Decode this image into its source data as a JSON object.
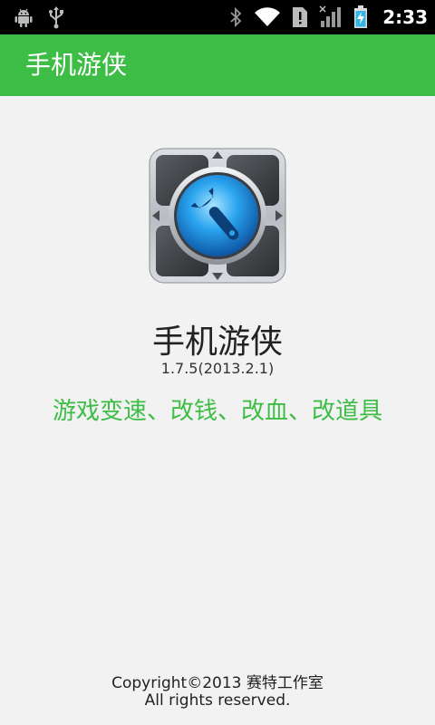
{
  "status_bar": {
    "time": "2:33",
    "left_icons": [
      "android-debug-icon",
      "usb-icon"
    ],
    "right_icons": [
      "bluetooth-icon",
      "wifi-icon",
      "sim-alert-icon",
      "signal-icon",
      "battery-charging-icon"
    ]
  },
  "title_bar": {
    "title": "手机游侠",
    "color": "#3dbd46"
  },
  "app": {
    "icon": "wrench-gamepad-icon",
    "name": "手机游侠",
    "version": "1.7.5(2013.2.1)",
    "tagline": "游戏变速、改钱、改血、改道具",
    "tagline_color": "#3dbd46"
  },
  "footer": {
    "copyright": "Copyright©2013 赛特工作室",
    "rights": "All rights reserved."
  }
}
